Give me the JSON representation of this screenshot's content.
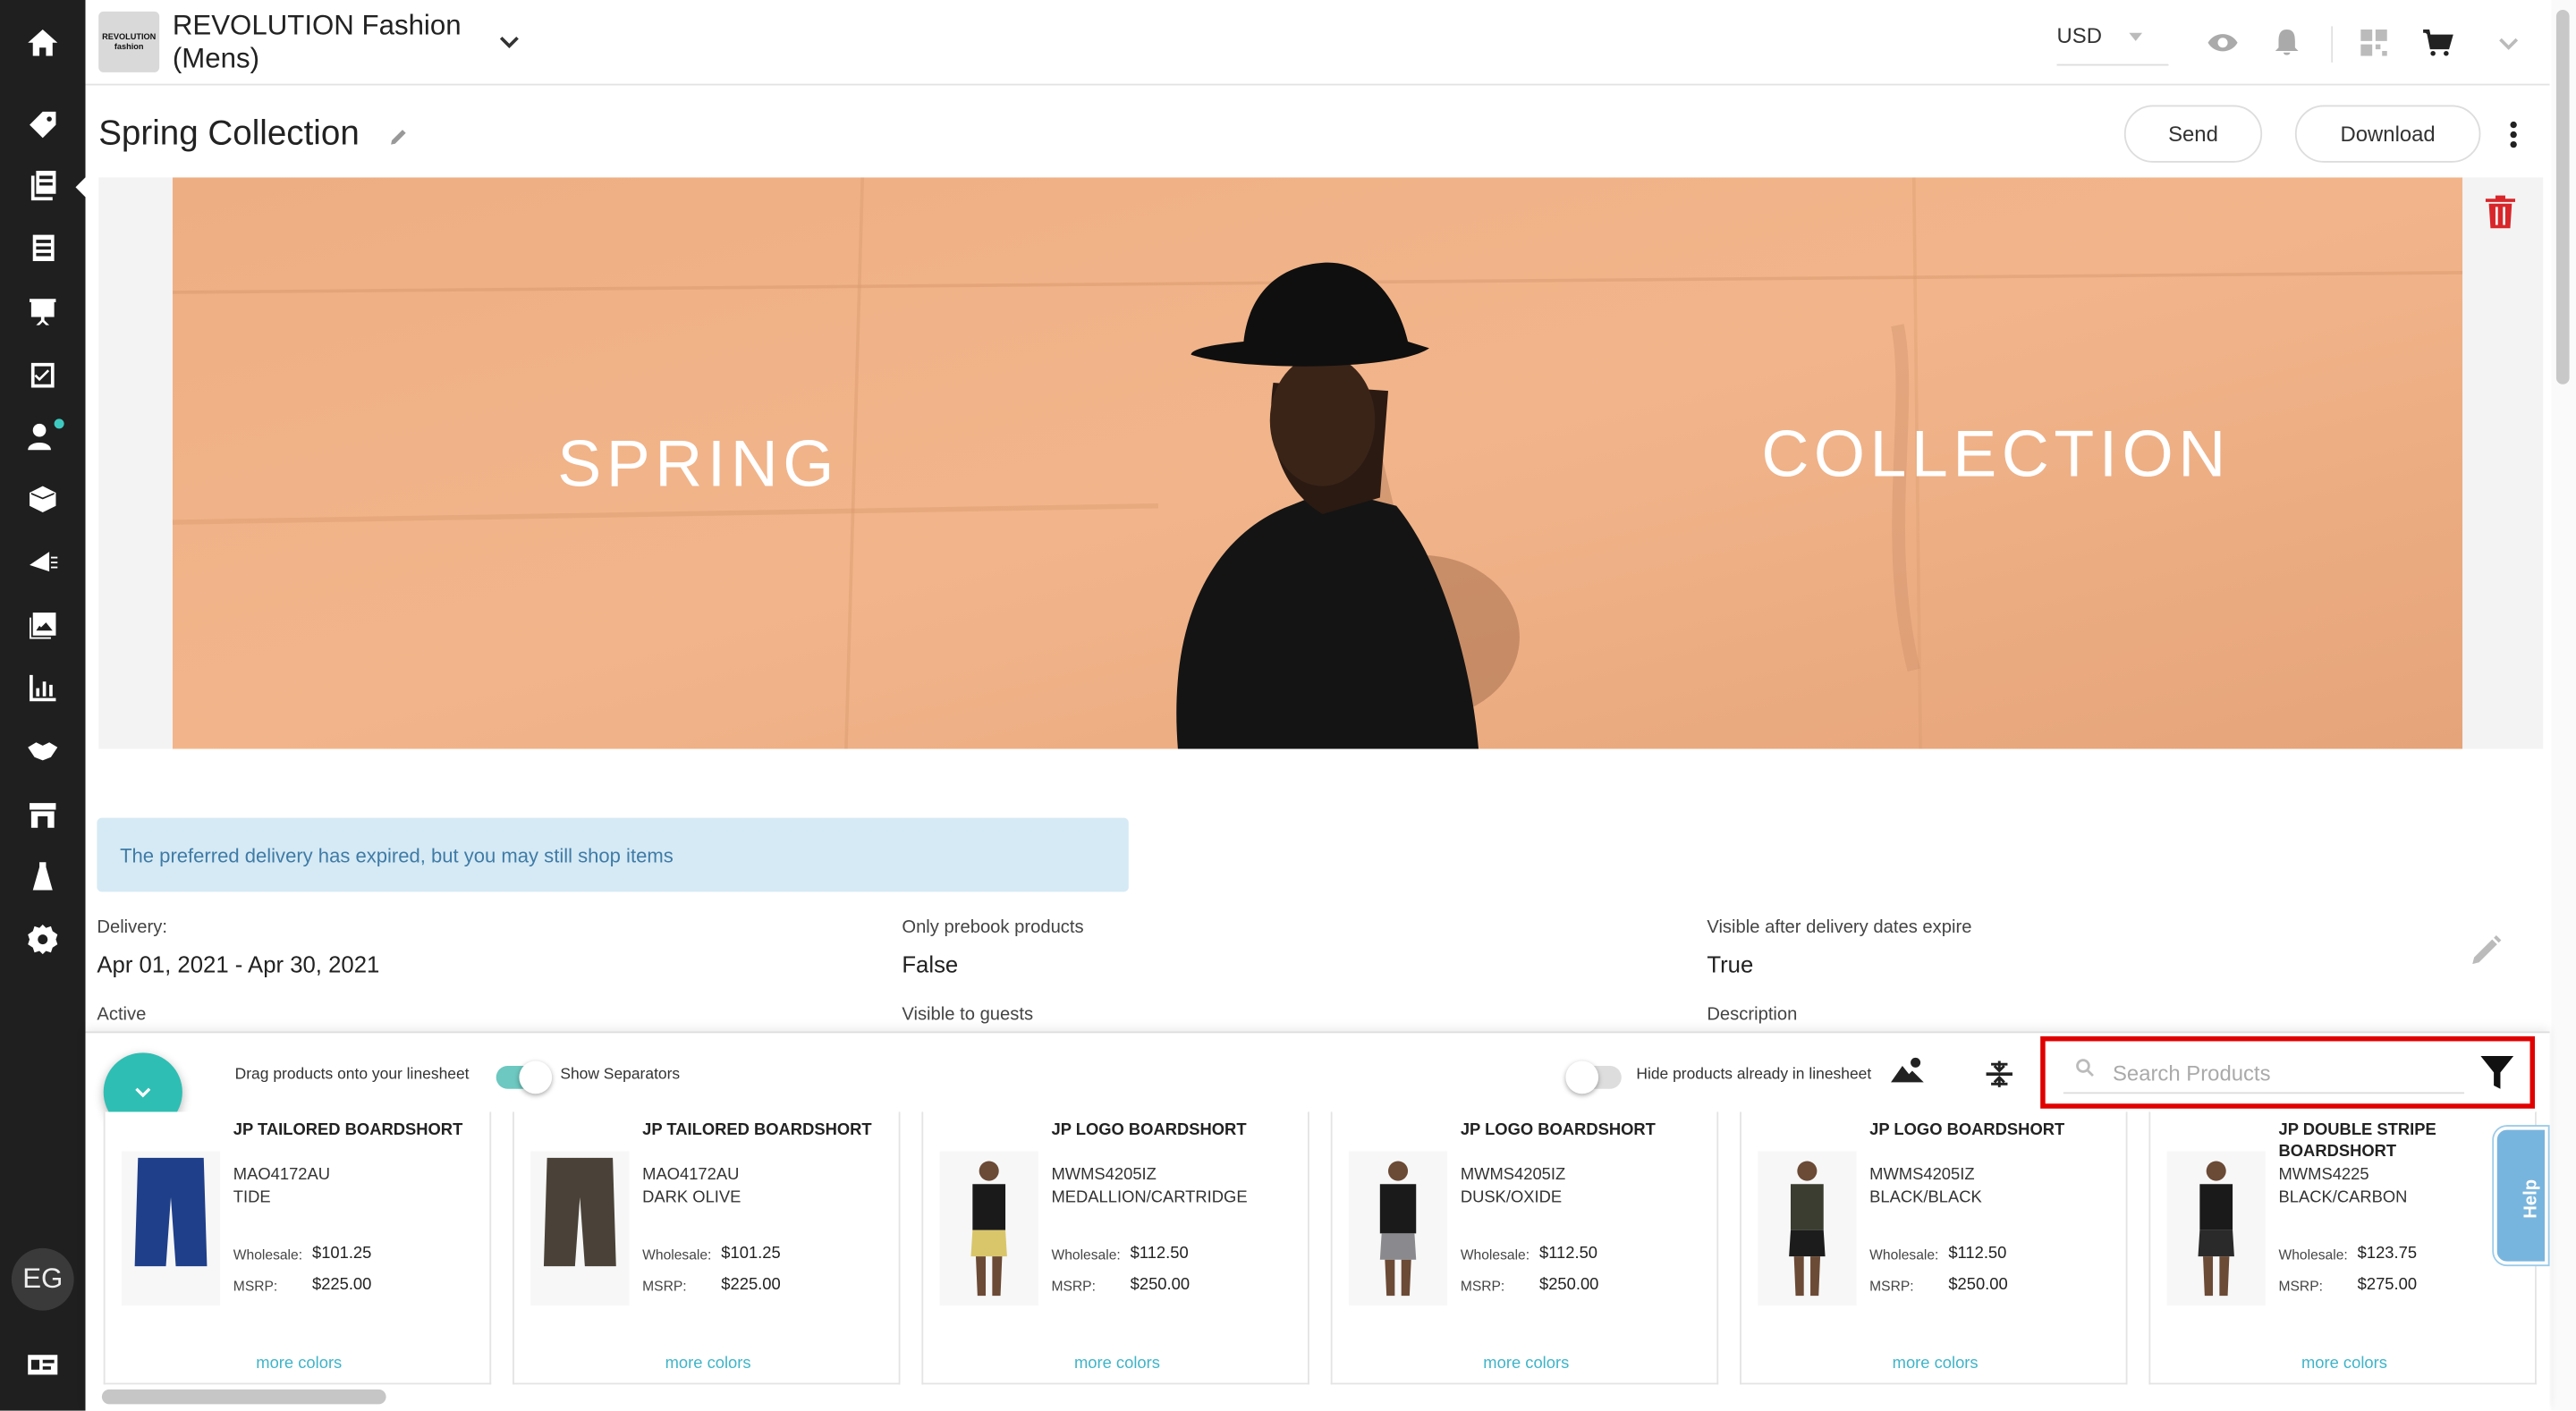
{
  "nav": {
    "items": [
      "home-icon",
      "tag-icon",
      "linesheet-icon",
      "catalog-icon",
      "presentation-icon",
      "checklist-icon",
      "users-icon",
      "box-icon",
      "campaign-icon",
      "images-icon",
      "reports-icon",
      "handshake-icon",
      "store-icon",
      "brand-icon",
      "settings-icon"
    ],
    "avatar_initials": "EG"
  },
  "header": {
    "logo_top": "REVOLUTION",
    "logo_bottom": "fashion",
    "brand": "REVOLUTION Fashion (Mens)",
    "currency": "USD"
  },
  "page": {
    "title": "Spring Collection",
    "send_label": "Send",
    "download_label": "Download"
  },
  "banner": {
    "left_text": "SPRING",
    "right_text": "COLLECTION"
  },
  "alert": {
    "text": "The preferred delivery has expired, but you may still shop items"
  },
  "details": {
    "delivery_label": "Delivery:",
    "delivery_value": "Apr 01, 2021 - Apr 30, 2021",
    "prebook_label": "Only prebook products",
    "prebook_value": "False",
    "visible_after_label": "Visible after delivery dates expire",
    "visible_after_value": "True",
    "active_label": "Active",
    "guests_label": "Visible to guests",
    "description_label": "Description"
  },
  "drawer": {
    "drag_hint": "Drag products onto your linesheet",
    "show_separators_label": "Show Separators",
    "show_separators_on": true,
    "hide_products_label": "Hide products already in linesheet",
    "hide_products_on": false,
    "search_placeholder": "Search Products",
    "help_label": "Help"
  },
  "products": [
    {
      "name": "JP TAILORED BOARDSHORT",
      "sku": "MAO4172AU",
      "color": "TIDE",
      "wholesale_label": "Wholesale:",
      "wholesale": "$101.25",
      "msrp_label": "MSRP:",
      "msrp": "$225.00",
      "more": "more colors",
      "swatch": "#1f3f8a"
    },
    {
      "name": "JP TAILORED BOARDSHORT",
      "sku": "MAO4172AU",
      "color": "DARK OLIVE",
      "wholesale_label": "Wholesale:",
      "wholesale": "$101.25",
      "msrp_label": "MSRP:",
      "msrp": "$225.00",
      "more": "more colors",
      "swatch": "#4a4238"
    },
    {
      "name": "JP LOGO BOARDSHORT",
      "sku": "MWMS4205IZ",
      "color": "MEDALLION/CARTRIDGE",
      "wholesale_label": "Wholesale:",
      "wholesale": "$112.50",
      "msrp_label": "MSRP:",
      "msrp": "$250.00",
      "more": "more colors",
      "swatch": "#d9c66a"
    },
    {
      "name": "JP LOGO BOARDSHORT",
      "sku": "MWMS4205IZ",
      "color": "DUSK/OXIDE",
      "wholesale_label": "Wholesale:",
      "wholesale": "$112.50",
      "msrp_label": "MSRP:",
      "msrp": "$250.00",
      "more": "more colors",
      "swatch": "#8a8a8e"
    },
    {
      "name": "JP LOGO BOARDSHORT",
      "sku": "MWMS4205IZ",
      "color": "BLACK/BLACK",
      "wholesale_label": "Wholesale:",
      "wholesale": "$112.50",
      "msrp_label": "MSRP:",
      "msrp": "$250.00",
      "more": "more colors",
      "swatch": "#1c1c1c"
    },
    {
      "name": "JP DOUBLE STRIPE BOARDSHORT",
      "sku": "MWMS4225",
      "color": "BLACK/CARBON",
      "wholesale_label": "Wholesale:",
      "wholesale": "$123.75",
      "msrp_label": "MSRP:",
      "msrp": "$275.00",
      "more": "more colors",
      "swatch": "#2a2a2a"
    }
  ]
}
